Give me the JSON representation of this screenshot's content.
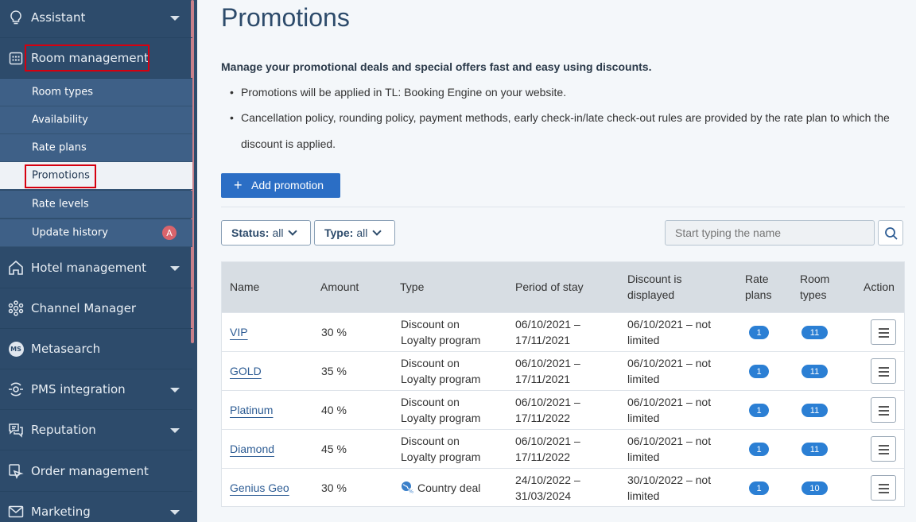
{
  "sidebar": {
    "items": [
      {
        "label": "Assistant",
        "icon": "lightbulb-icon"
      },
      {
        "label": "Room management",
        "icon": "calendar-icon"
      },
      {
        "label": "Hotel management",
        "icon": "house-icon"
      },
      {
        "label": "Channel Manager",
        "icon": "network-icon"
      },
      {
        "label": "Metasearch",
        "icon": "ms-icon",
        "icon_text": "MS"
      },
      {
        "label": "PMS integration",
        "icon": "link-icon"
      },
      {
        "label": "Reputation",
        "icon": "chat-icon"
      },
      {
        "label": "Order management",
        "icon": "order-icon"
      },
      {
        "label": "Marketing",
        "icon": "mail-icon"
      }
    ],
    "sub_items": [
      {
        "label": "Room types"
      },
      {
        "label": "Availability"
      },
      {
        "label": "Rate plans"
      },
      {
        "label": "Promotions"
      },
      {
        "label": "Rate levels"
      },
      {
        "label": "Update history",
        "badge": "A"
      }
    ]
  },
  "page": {
    "title": "Promotions",
    "intro": "Manage your promotional deals and special offers fast and easy using discounts.",
    "bullets": [
      "Promotions will be applied in TL: Booking Engine on your website.",
      "Cancellation policy, rounding policy, payment methods, early check-in/late check-out rules are provided by the rate plan to which the discount is applied."
    ],
    "add_button": "Add promotion",
    "filters": {
      "status_label": "Status:",
      "status_value": "all",
      "type_label": "Type:",
      "type_value": "all"
    },
    "search_placeholder": "Start typing the name"
  },
  "table": {
    "headers": {
      "name": "Name",
      "amount": "Amount",
      "type": "Type",
      "period": "Period of stay",
      "displayed_1": "Discount is",
      "displayed_2": "displayed",
      "rate_1": "Rate",
      "rate_2": "plans",
      "room_1": "Room",
      "room_2": "types",
      "action": "Action"
    },
    "rows": [
      {
        "name": "VIP",
        "amount": "30 %",
        "type_1": "Discount on",
        "type_2": "Loyalty program",
        "period_1": "06/10/2021 –",
        "period_2": "17/11/2021",
        "disp_1": "06/10/2021 – not",
        "disp_2": "limited",
        "rate_plans": "1",
        "room_types": "11"
      },
      {
        "name": "GOLD",
        "amount": "35 %",
        "type_1": "Discount on",
        "type_2": "Loyalty program",
        "period_1": "06/10/2021 –",
        "period_2": "17/11/2021",
        "disp_1": "06/10/2021 – not",
        "disp_2": "limited",
        "rate_plans": "1",
        "room_types": "11"
      },
      {
        "name": "Platinum",
        "amount": "40 %",
        "type_1": "Discount on",
        "type_2": "Loyalty program",
        "period_1": "06/10/2021 –",
        "period_2": "17/11/2022",
        "disp_1": "06/10/2021 – not",
        "disp_2": "limited",
        "rate_plans": "1",
        "room_types": "11"
      },
      {
        "name": "Diamond",
        "amount": "45 %",
        "type_1": "Discount on",
        "type_2": "Loyalty program",
        "period_1": "06/10/2021 –",
        "period_2": "17/11/2022",
        "disp_1": "06/10/2021 – not",
        "disp_2": "limited",
        "rate_plans": "1",
        "room_types": "11"
      },
      {
        "name": "Genius Geo",
        "amount": "30 %",
        "type_1": "Country deal",
        "type_2": "",
        "type_icon": "globe-percent-icon",
        "period_1": "24/10/2022 –",
        "period_2": "31/03/2024",
        "disp_1": "30/10/2022 – not",
        "disp_2": "limited",
        "rate_plans": "1",
        "room_types": "10"
      }
    ]
  }
}
